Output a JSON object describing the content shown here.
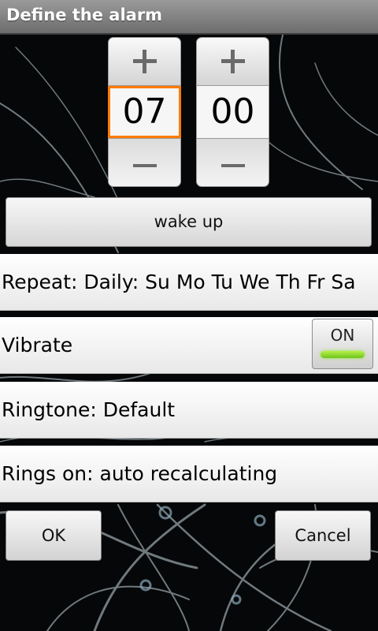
{
  "title_bar": {
    "title": "Define the alarm"
  },
  "time_picker": {
    "hour": {
      "value": "07",
      "increment_icon": "plus-icon",
      "decrement_icon": "minus-icon"
    },
    "minute": {
      "value": "00",
      "increment_icon": "plus-icon",
      "decrement_icon": "minus-icon"
    }
  },
  "alarm_name_button": {
    "label": "wake up"
  },
  "settings": {
    "repeat": {
      "label": "Repeat: Daily:  Su Mo Tu We Th Fr Sa"
    },
    "vibrate": {
      "label": "Vibrate",
      "toggle_label": "ON",
      "toggle_indicator_color": "#8fdc2e"
    },
    "ringtone": {
      "label": "Ringtone: Default"
    },
    "rings_on": {
      "label": "Rings on: auto recalculating"
    }
  },
  "dialog_buttons": {
    "ok_label": "OK",
    "cancel_label": "Cancel"
  },
  "colors": {
    "focus_border": "#ff7b00",
    "title_bar_bg": "#8a8a8a"
  }
}
